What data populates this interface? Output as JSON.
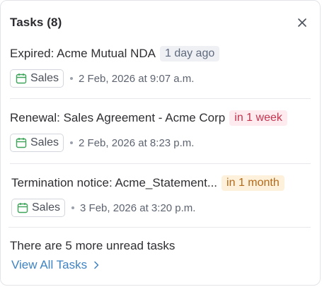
{
  "header": {
    "title": "Tasks (8)",
    "close_icon": "close-icon"
  },
  "tasks": [
    {
      "title": "Expired: Acme Mutual NDA",
      "due_badge": "1 day ago",
      "due_color": "#5f6a7d",
      "tag": "Sales",
      "tag_icon": "calendar-icon",
      "date": "2 Feb, 2026 at 9:07 a.m."
    },
    {
      "title": "Renewal: Sales Agreement - Acme Corp",
      "due_badge": "in 1 week",
      "due_color": "#c3344f",
      "tag": "Sales",
      "tag_icon": "calendar-icon",
      "date": "2 Feb, 2026 at 8:23 p.m."
    },
    {
      "title": "Termination notice: Acme_Statement...",
      "due_badge": "in 1 month",
      "due_color": "#b46a19",
      "tag": "Sales",
      "tag_icon": "calendar-icon",
      "date": "3 Feb, 2026 at 3:20 p.m."
    }
  ],
  "footer": {
    "more_text": "There are 5 more unread tasks",
    "view_all_label": "View All Tasks",
    "view_all_icon": "chevron-right-icon",
    "link_color": "#3f83c2"
  }
}
